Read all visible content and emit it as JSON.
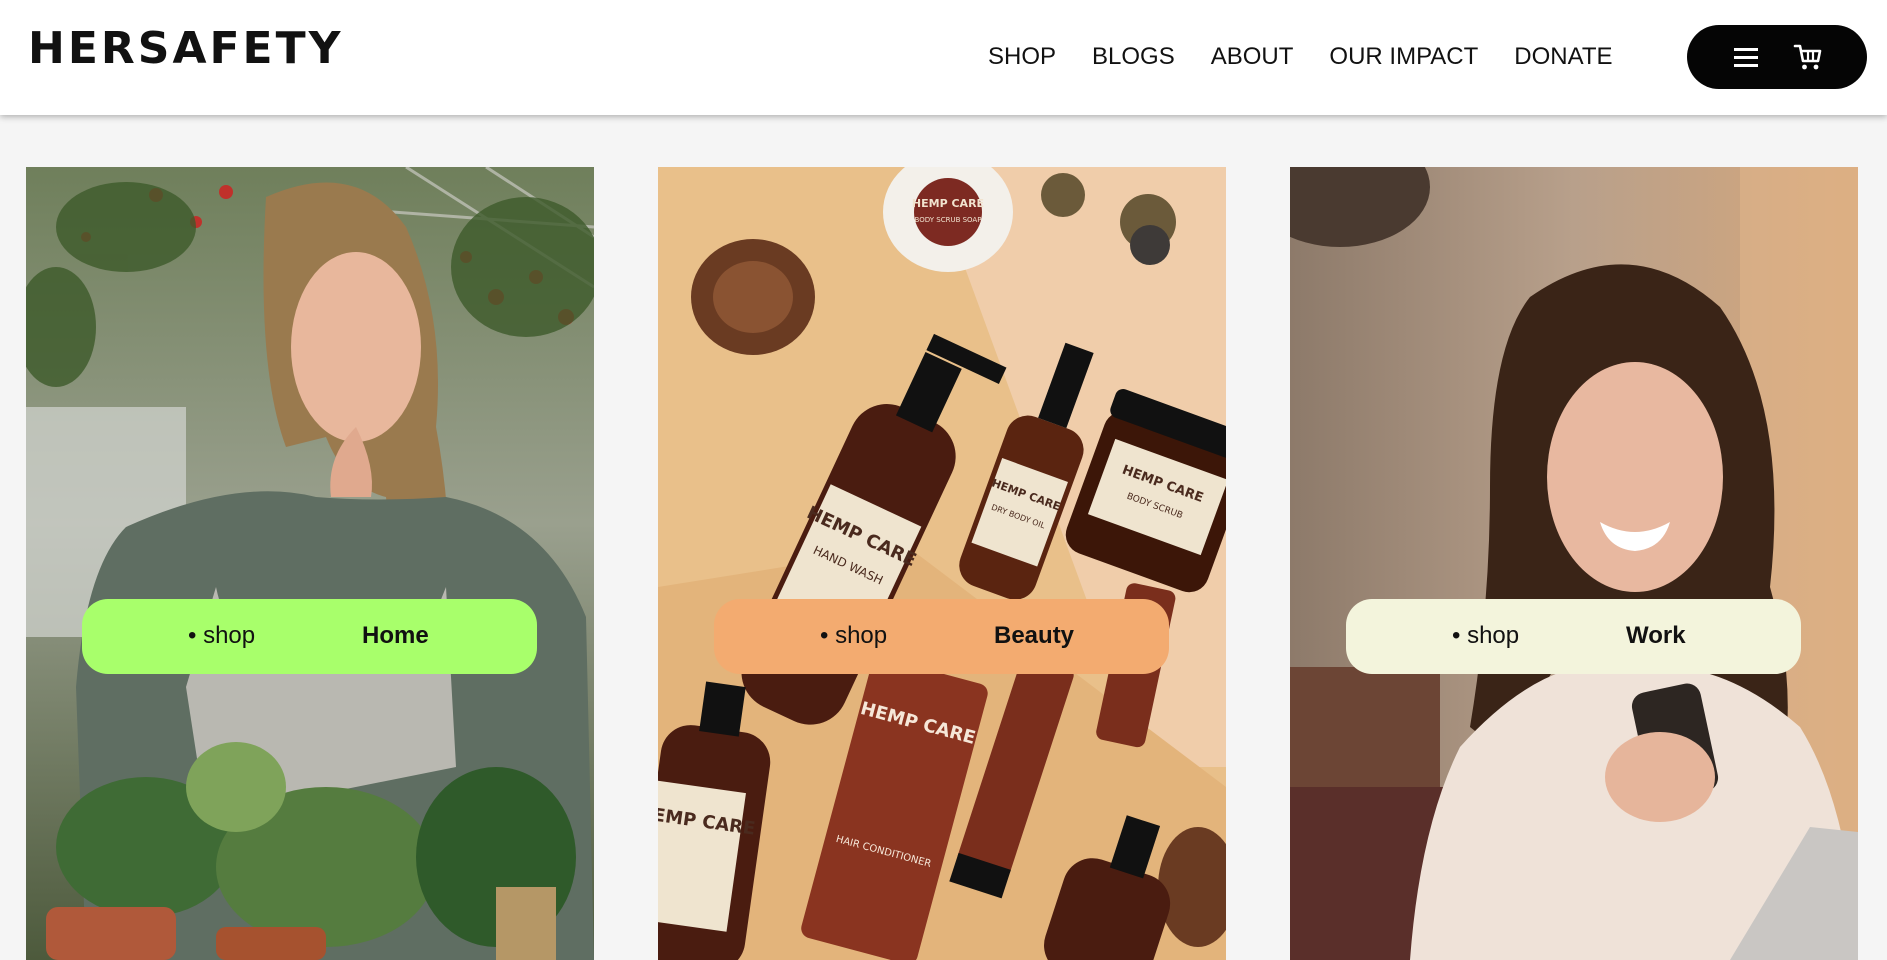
{
  "brand": {
    "logo_text": "HERSAFETY"
  },
  "nav": {
    "items": [
      {
        "label": "SHOP"
      },
      {
        "label": "BLOGS"
      },
      {
        "label": "ABOUT"
      },
      {
        "label": "OUR IMPACT"
      },
      {
        "label": "DONATE"
      }
    ]
  },
  "actions": {
    "menu_icon": "hamburger-menu-icon",
    "cart_icon": "shopping-cart-icon"
  },
  "cards": [
    {
      "shop_label": "• shop",
      "category": "Home",
      "badge_color": "#a8ff6b",
      "image": "woman-gardener-with-potted-plants"
    },
    {
      "shop_label": "• shop",
      "category": "Beauty",
      "badge_color": "#f3ab70",
      "image": "hemp-care-beauty-products-flatlay"
    },
    {
      "shop_label": "• shop",
      "category": "Work",
      "badge_color": "#f3f4dc",
      "image": "woman-smiling-at-phone"
    }
  ],
  "image_text": {
    "hemp_brand": "HEMP CARE",
    "hand_wash": "HAND WASH",
    "body_scrub": "BODY SCRUB",
    "dry_body_oil": "DRY BODY OIL",
    "soap": "BODY SCRUB SOAP",
    "hair_conditioner": "HAIR CONDITIONER"
  },
  "theme": {
    "header_bg": "#ffffff",
    "page_bg": "#f5f5f5",
    "pill_bg": "#050505"
  }
}
